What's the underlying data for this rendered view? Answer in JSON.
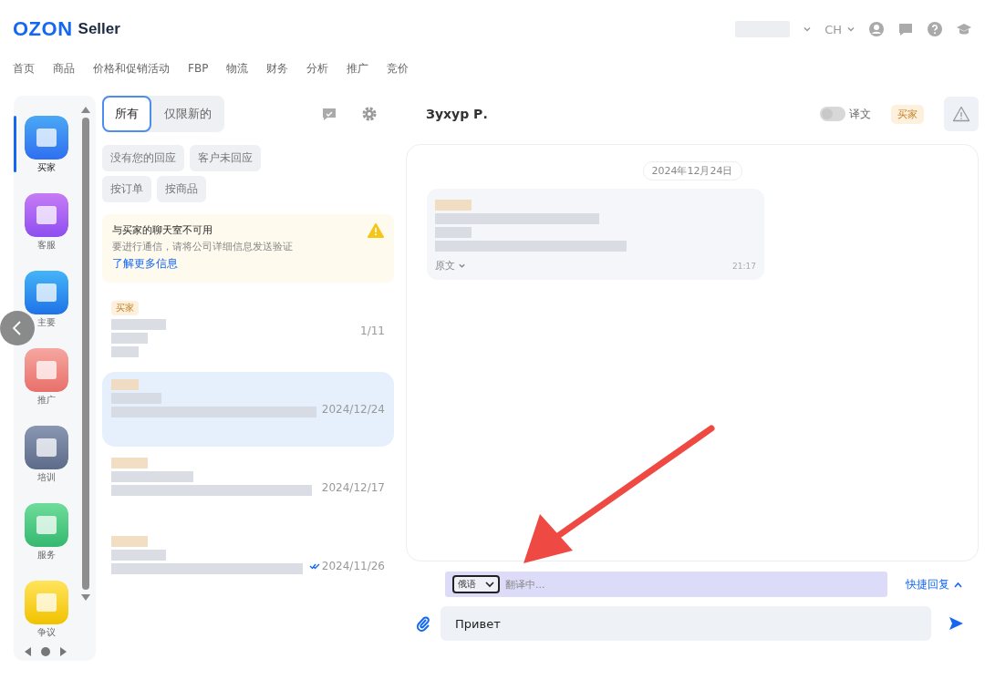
{
  "header": {
    "logo": "OZON",
    "product": "Seller",
    "language": "CH"
  },
  "nav": [
    {
      "label": "首页"
    },
    {
      "label": "商品"
    },
    {
      "label": "价格和促销活动"
    },
    {
      "label": "FBP"
    },
    {
      "label": "物流"
    },
    {
      "label": "财务"
    },
    {
      "label": "分析"
    },
    {
      "label": "推广"
    },
    {
      "label": "竞价"
    }
  ],
  "sidebar": {
    "items": [
      {
        "label": "买家",
        "kind": "buyer",
        "selected": true
      },
      {
        "label": "客服",
        "kind": "support",
        "selected": false
      },
      {
        "label": "主要",
        "kind": "mail",
        "selected": false
      },
      {
        "label": "推广",
        "kind": "promo",
        "selected": false
      },
      {
        "label": "培训",
        "kind": "training",
        "selected": false
      },
      {
        "label": "服务",
        "kind": "service",
        "selected": false
      },
      {
        "label": "争议",
        "kind": "dispute",
        "selected": false
      }
    ]
  },
  "filters": {
    "tabs": [
      {
        "label": "所有",
        "selected": true
      },
      {
        "label": "仅限新的",
        "selected": false
      }
    ],
    "chips": [
      "没有您的回应",
      "客户未回应",
      "按订单",
      "按商品"
    ]
  },
  "notice": {
    "title": "与买家的聊天室不可用",
    "text": "要进行通信，请将公司详细信息发送验证",
    "link": "了解更多信息"
  },
  "conversations": [
    {
      "tag": "买家",
      "meta": "1/11",
      "selected": false,
      "read": false
    },
    {
      "meta": "2024/12/24",
      "selected": true,
      "read": false
    },
    {
      "meta": "2024/12/17",
      "selected": false,
      "read": false
    },
    {
      "meta": "2024/11/26",
      "selected": false,
      "read": true
    }
  ],
  "chat": {
    "name": "Зухур Р.",
    "translate_label": "译文",
    "translate_on": false,
    "role_badge": "买家",
    "date": "2024年12月24日",
    "message": {
      "original_toggle": "原文",
      "time": "21:17"
    }
  },
  "composer": {
    "language": "俄语",
    "status": "翻译中...",
    "quick_reply": "快捷回复",
    "value": "Привет"
  }
}
